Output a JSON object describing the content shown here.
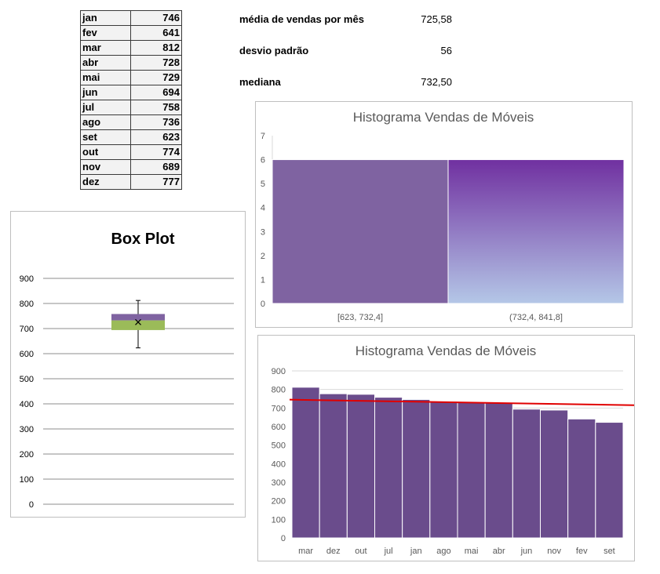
{
  "table": {
    "rows": [
      {
        "month": "jan",
        "value": "746"
      },
      {
        "month": "fev",
        "value": "641"
      },
      {
        "month": "mar",
        "value": "812"
      },
      {
        "month": "abr",
        "value": "728"
      },
      {
        "month": "mai",
        "value": "729"
      },
      {
        "month": "jun",
        "value": "694"
      },
      {
        "month": "jul",
        "value": "758"
      },
      {
        "month": "ago",
        "value": "736"
      },
      {
        "month": "set",
        "value": "623"
      },
      {
        "month": "out",
        "value": "774"
      },
      {
        "month": "nov",
        "value": "689"
      },
      {
        "month": "dez",
        "value": "777"
      }
    ]
  },
  "stats": {
    "mean_label": "média de vendas por mês",
    "mean_value": "725,58",
    "std_label": "desvio padrão",
    "std_value": "56",
    "median_label": "mediana",
    "median_value": "732,50"
  },
  "colors": {
    "purple": "#7f63a1",
    "purple_dark": "#6a4c8c",
    "green": "#9bbb59",
    "trend": "#e00000",
    "grid": "#d9d9d9",
    "axis_text": "#595959"
  },
  "chart_data": [
    {
      "type": "bar",
      "title": "Box Plot",
      "ylim": [
        0,
        900
      ],
      "yticks": [
        0,
        100,
        200,
        300,
        400,
        500,
        600,
        700,
        800,
        900
      ],
      "box": {
        "min": 623,
        "q1": 694,
        "median": 732.5,
        "q3": 758,
        "max": 812,
        "mean": 725.58
      },
      "grid": true
    },
    {
      "type": "bar",
      "title": "Histograma Vendas de Móveis",
      "categories": [
        "[623, 732,4]",
        "(732,4, 841,8]"
      ],
      "values": [
        6,
        6
      ],
      "ylim": [
        0,
        7
      ],
      "yticks": [
        0,
        1,
        2,
        3,
        4,
        5,
        6,
        7
      ],
      "grid": false
    },
    {
      "type": "bar",
      "title": "Histograma Vendas de Móveis",
      "categories": [
        "mar",
        "dez",
        "out",
        "jul",
        "jan",
        "ago",
        "mai",
        "abr",
        "jun",
        "nov",
        "fev",
        "set"
      ],
      "values": [
        812,
        777,
        774,
        758,
        746,
        736,
        729,
        728,
        694,
        689,
        641,
        623
      ],
      "ylim": [
        0,
        900
      ],
      "yticks": [
        0,
        100,
        200,
        300,
        400,
        500,
        600,
        700,
        800,
        900
      ],
      "trendline": {
        "start": 745,
        "end": 715
      },
      "grid": true
    }
  ]
}
